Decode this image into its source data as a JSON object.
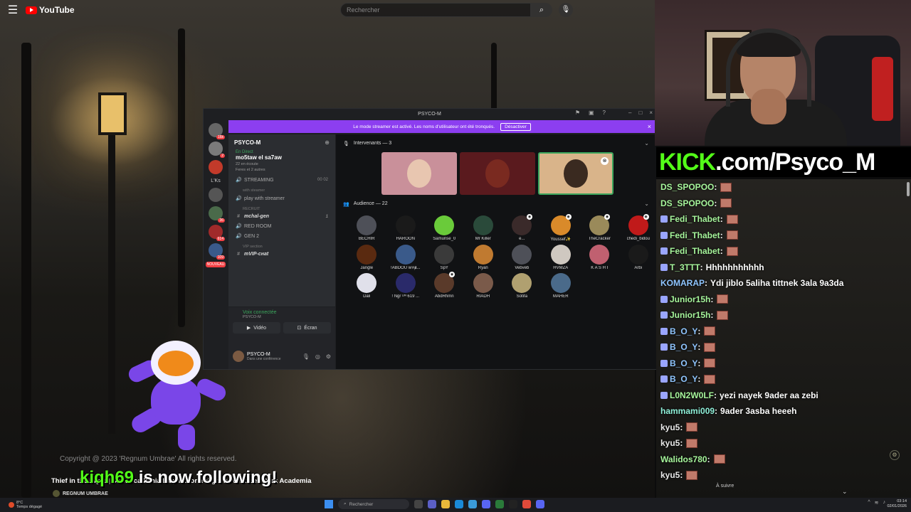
{
  "youtube": {
    "logo_text": "YouTube",
    "search_placeholder": "Rechercher"
  },
  "discord": {
    "window_title": "PSYCO-M",
    "banner": {
      "text": "Le mode streamer est activé. Les noms d'utilisateur ont été tronqués.",
      "button_label": "Désactiver"
    },
    "guild_badges": [
      "16k",
      "2",
      "",
      "L'Ks",
      "",
      "36",
      "614",
      "109",
      "NOUVEAU"
    ],
    "server": {
      "name": "PSYCO-M",
      "live_tag": "En Direct",
      "live_title": "mo5taw el sa7aw",
      "live_listeners": "22 en écoute",
      "live_people": "Feres et 2 autres"
    },
    "channels": [
      {
        "icon": "🔊",
        "label": "STREAMING",
        "right": "00 02",
        "bold": false
      },
      {
        "icon": "",
        "label": "with steamer",
        "right": "+",
        "bold": false,
        "section": true
      },
      {
        "icon": "🔊",
        "label": "play with streamer",
        "right": "",
        "bold": false
      },
      {
        "icon": "",
        "label": "RECRUIT",
        "right": "+",
        "bold": false,
        "section": true
      },
      {
        "icon": "#",
        "label": "тchal-gen",
        "right": "1",
        "bold": true
      },
      {
        "icon": "🔊",
        "label": "RED ROOM",
        "right": "",
        "bold": false
      },
      {
        "icon": "🔊",
        "label": "GEN 2",
        "right": "",
        "bold": false
      },
      {
        "icon": "",
        "label": "VIP section",
        "right": "+",
        "bold": false,
        "section": true
      },
      {
        "icon": "#",
        "label": "тVIP-cнat",
        "right": "",
        "bold": true
      }
    ],
    "voice": {
      "status": "Voix connectée",
      "channel": "PSYCO-M",
      "video_label": "Vidéo",
      "screen_label": "Écran"
    },
    "user": {
      "name": "PSYCO-M",
      "status": "Dans une conférence"
    },
    "stage": {
      "speakers_label": "Intervenants — 3",
      "audience_label": "Audience — 22",
      "speakers": [
        {
          "bg": "#c9909a",
          "face": "#e8c6b0",
          "active": false
        },
        {
          "bg": "#5a1a1e",
          "face": "#7a2a20",
          "active": false
        },
        {
          "bg": "#d9b48a",
          "face": "#3a2a20",
          "active": true
        }
      ],
      "audience": [
        {
          "name": "BECHIR",
          "color": "#4e5058"
        },
        {
          "name": "HAROON",
          "color": "#1a1a1a"
        },
        {
          "name": "Samurise_0",
          "color": "#6acb3a"
        },
        {
          "name": "Mr Killer",
          "color": "#2a4a3a"
        },
        {
          "name": "e...",
          "color": "#3a2a2a"
        },
        {
          "name": "Youssef✨",
          "color": "#d98a2a"
        },
        {
          "name": "TheCracker",
          "color": "#9a8a5a"
        },
        {
          "name": "chedi_bidou",
          "color": "#c01a1a"
        },
        {
          "name": "Jangle",
          "color": "#5a2a10"
        },
        {
          "name": "!ABDOU ⱳ#ⱥ...",
          "color": "#3a5a8a"
        },
        {
          "name": "SpY",
          "color": "#3a3a3a"
        },
        {
          "name": "Ryan",
          "color": "#c07a30"
        },
        {
          "name": "Vebveb",
          "color": "#4e5058"
        },
        {
          "name": "HVMZA",
          "color": "#cfc8c0"
        },
        {
          "name": "K A S H I",
          "color": "#c06070"
        },
        {
          "name": "Arbi",
          "color": "#1a1a1a"
        },
        {
          "name": "Dali",
          "color": "#e0e0ea"
        },
        {
          "name": "! Ngr ᴸᴵᴺ 619 ...",
          "color": "#2a2a6a"
        },
        {
          "name": "AbdRhmn",
          "color": "#5a3a2a"
        },
        {
          "name": "RIADH",
          "color": "#7a5a4a"
        },
        {
          "name": "Sotifa",
          "color": "#b0a070"
        },
        {
          "name": "MAHER",
          "color": "#4a6a8a"
        }
      ]
    }
  },
  "kick_banner": {
    "prefix": "KICK",
    "rest": ".com/Psyco_M"
  },
  "chat": {
    "messages": [
      {
        "user": "DS_SPOPOO",
        "cls": "u-green",
        "text": "",
        "emote": true,
        "badge": false
      },
      {
        "user": "DS_SPOPOO",
        "cls": "u-green",
        "text": "",
        "emote": true,
        "badge": false
      },
      {
        "user": "Fedi_Thabet",
        "cls": "u-green",
        "text": "",
        "emote": true,
        "badge": true
      },
      {
        "user": "Fedi_Thabet",
        "cls": "u-green",
        "text": "",
        "emote": true,
        "badge": true
      },
      {
        "user": "Fedi_Thabet",
        "cls": "u-green",
        "text": "",
        "emote": true,
        "badge": true
      },
      {
        "user": "T_3TTT",
        "cls": "u-green",
        "text": "Hhhhhhhhhhh",
        "emote": false,
        "badge": true
      },
      {
        "user": "KOMARAP",
        "cls": "u-blue",
        "text": "Ydi jiblo 5aliha tittnek 3ala 9a3da",
        "emote": false,
        "badge": false
      },
      {
        "user": "Junior15h",
        "cls": "u-green",
        "text": "",
        "emote": true,
        "badge": true
      },
      {
        "user": "Junior15h",
        "cls": "u-green",
        "text": "",
        "emote": true,
        "badge": true
      },
      {
        "user": "B_O_Y",
        "cls": "u-blue",
        "text": "",
        "emote": true,
        "badge": true
      },
      {
        "user": "B_O_Y",
        "cls": "u-blue",
        "text": "",
        "emote": true,
        "badge": true
      },
      {
        "user": "B_O_Y",
        "cls": "u-blue",
        "text": "",
        "emote": true,
        "badge": true
      },
      {
        "user": "B_O_Y",
        "cls": "u-blue",
        "text": "",
        "emote": true,
        "badge": true
      },
      {
        "user": "L0N2W0LF",
        "cls": "u-green",
        "text": "yezi nayek 9ader aa zebi",
        "emote": false,
        "badge": true
      },
      {
        "user": "hammami009",
        "cls": "u-cyan",
        "text": "9ader 3asba heeeh",
        "emote": false,
        "badge": false
      },
      {
        "user": "kyu5",
        "cls": "u-plain",
        "text": "",
        "emote": true,
        "badge": false
      },
      {
        "user": "kyu5",
        "cls": "u-plain",
        "text": "",
        "emote": true,
        "badge": false
      },
      {
        "user": "Walidos780",
        "cls": "u-green",
        "text": "",
        "emote": true,
        "badge": false
      },
      {
        "user": "kyu5",
        "cls": "u-plain",
        "text": "",
        "emote": true,
        "badge": false
      }
    ],
    "resume_hint": "À suivre"
  },
  "overlay": {
    "copyright": "Copyright @ 2023 'Regnum Umbrae' All rights reserved.",
    "follower_name": "kiqh69",
    "follow_text": " is now following!",
    "video_title": "Thief in the Night | Dark Academia Playlist for a Night Adventure | Dark Academia",
    "channel_name": "REGNUM UMBRAE"
  },
  "taskbar": {
    "weather_temp": "8°C",
    "weather_text": "Temps dégagé",
    "search_label": "Rechercher",
    "time": "03:14",
    "date": "02/01/2026"
  }
}
